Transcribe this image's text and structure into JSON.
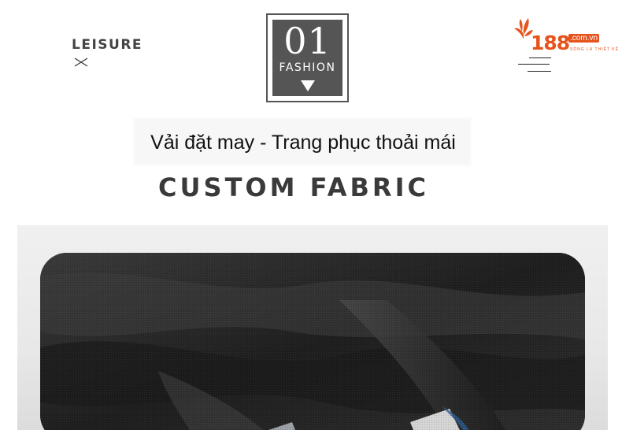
{
  "header": {
    "leisure_label": "LEISURE",
    "badge_number": "01",
    "badge_label": "FASHION"
  },
  "logo": {
    "number": "188",
    "domain": ".com.vn",
    "tagline": "SỐNG LÀ THIẾT KẾ"
  },
  "content": {
    "subtitle": "Vải đặt may - Trang phục thoải mái",
    "headline": "CUSTOM FABRIC"
  },
  "colors": {
    "brand": "#e6531c",
    "badge": "#555555",
    "fabric": "#2a2a2a"
  },
  "icons": {
    "cross": "cross-icon",
    "arrow": "arrow-down-icon",
    "menu": "menu-icon",
    "leaf": "leaf-icon"
  }
}
